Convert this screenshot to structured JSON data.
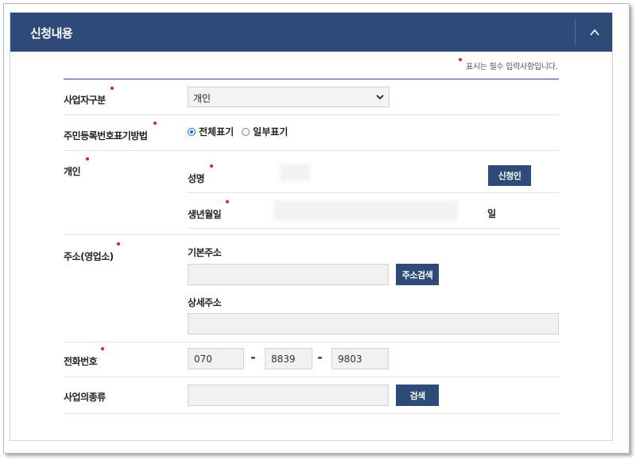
{
  "panel": {
    "title": "신청내용",
    "collapse_icon": "chevron-up-icon"
  },
  "notice": "표시는 필수 입력사항입니다.",
  "colors": {
    "header": "#2e4a78",
    "required": "#e02020"
  },
  "fields": {
    "business_type": {
      "label": "사업자구분",
      "value": "개인"
    },
    "rrn_method": {
      "label": "주민등록번호표기방법",
      "options": [
        "전체표기",
        "일부표기"
      ],
      "selected": "전체표기"
    },
    "individual": {
      "label": "개인",
      "name_label": "성명",
      "applicant_button": "신청인",
      "birth_label": "생년월일",
      "day_suffix": "일"
    },
    "address": {
      "label": "주소(영업소)",
      "basic_label": "기본주소",
      "basic_value": "",
      "search_button": "주소검색",
      "detail_label": "상세주소",
      "detail_value": ""
    },
    "phone": {
      "label": "전화번호",
      "part1": "070",
      "part2": "8839",
      "part3": "9803",
      "separator": "-"
    },
    "business_kind": {
      "label": "사업의종류",
      "value": "",
      "search_button": "검색"
    }
  }
}
